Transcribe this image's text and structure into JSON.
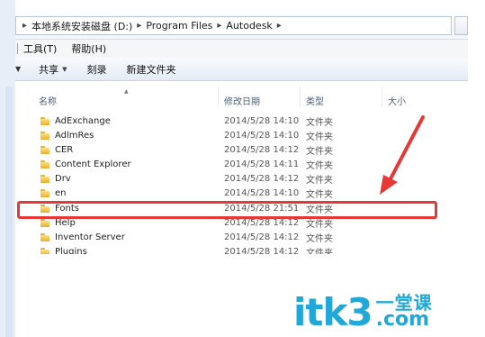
{
  "address_bar": {
    "crumbs": [
      "本地系统安装磁盘 (D:)",
      "Program Files",
      "Autodesk"
    ]
  },
  "menu": {
    "items": [
      "工具(T)",
      "帮助(H)"
    ]
  },
  "command_bar": {
    "share_label": "共享",
    "burn_label": "刻录",
    "new_folder_label": "新建文件夹"
  },
  "columns": {
    "name": "名称",
    "date": "修改日期",
    "type": "类型",
    "size": "大小"
  },
  "files": [
    {
      "name": "AdExchange",
      "date": "2014/5/28 14:10",
      "type": "文件夹"
    },
    {
      "name": "AdlmRes",
      "date": "2014/5/28 14:10",
      "type": "文件夹"
    },
    {
      "name": "CER",
      "date": "2014/5/28 14:12",
      "type": "文件夹"
    },
    {
      "name": "Content Explorer",
      "date": "2014/5/28 14:11",
      "type": "文件夹"
    },
    {
      "name": "Drv",
      "date": "2014/5/28 14:12",
      "type": "文件夹"
    },
    {
      "name": "en",
      "date": "2014/5/28 14:10",
      "type": "文件夹"
    },
    {
      "name": "Fonts",
      "date": "2014/5/28 21:51",
      "type": "文件夹"
    },
    {
      "name": "Help",
      "date": "2014/5/28 14:12",
      "type": "文件夹"
    },
    {
      "name": "Inventor Server",
      "date": "2014/5/28 14:12",
      "type": "文件夹"
    },
    {
      "name": "Plugins",
      "date": "2014/5/28 14:12",
      "type": "文件夹"
    }
  ],
  "selected_file": "Fonts",
  "watermark": {
    "brand": "itk3",
    "cn": "一堂课",
    "domain": ".com"
  },
  "colors": {
    "highlight": "#e53935",
    "brand": "#21a8d8",
    "folder": "#e5b02c"
  }
}
